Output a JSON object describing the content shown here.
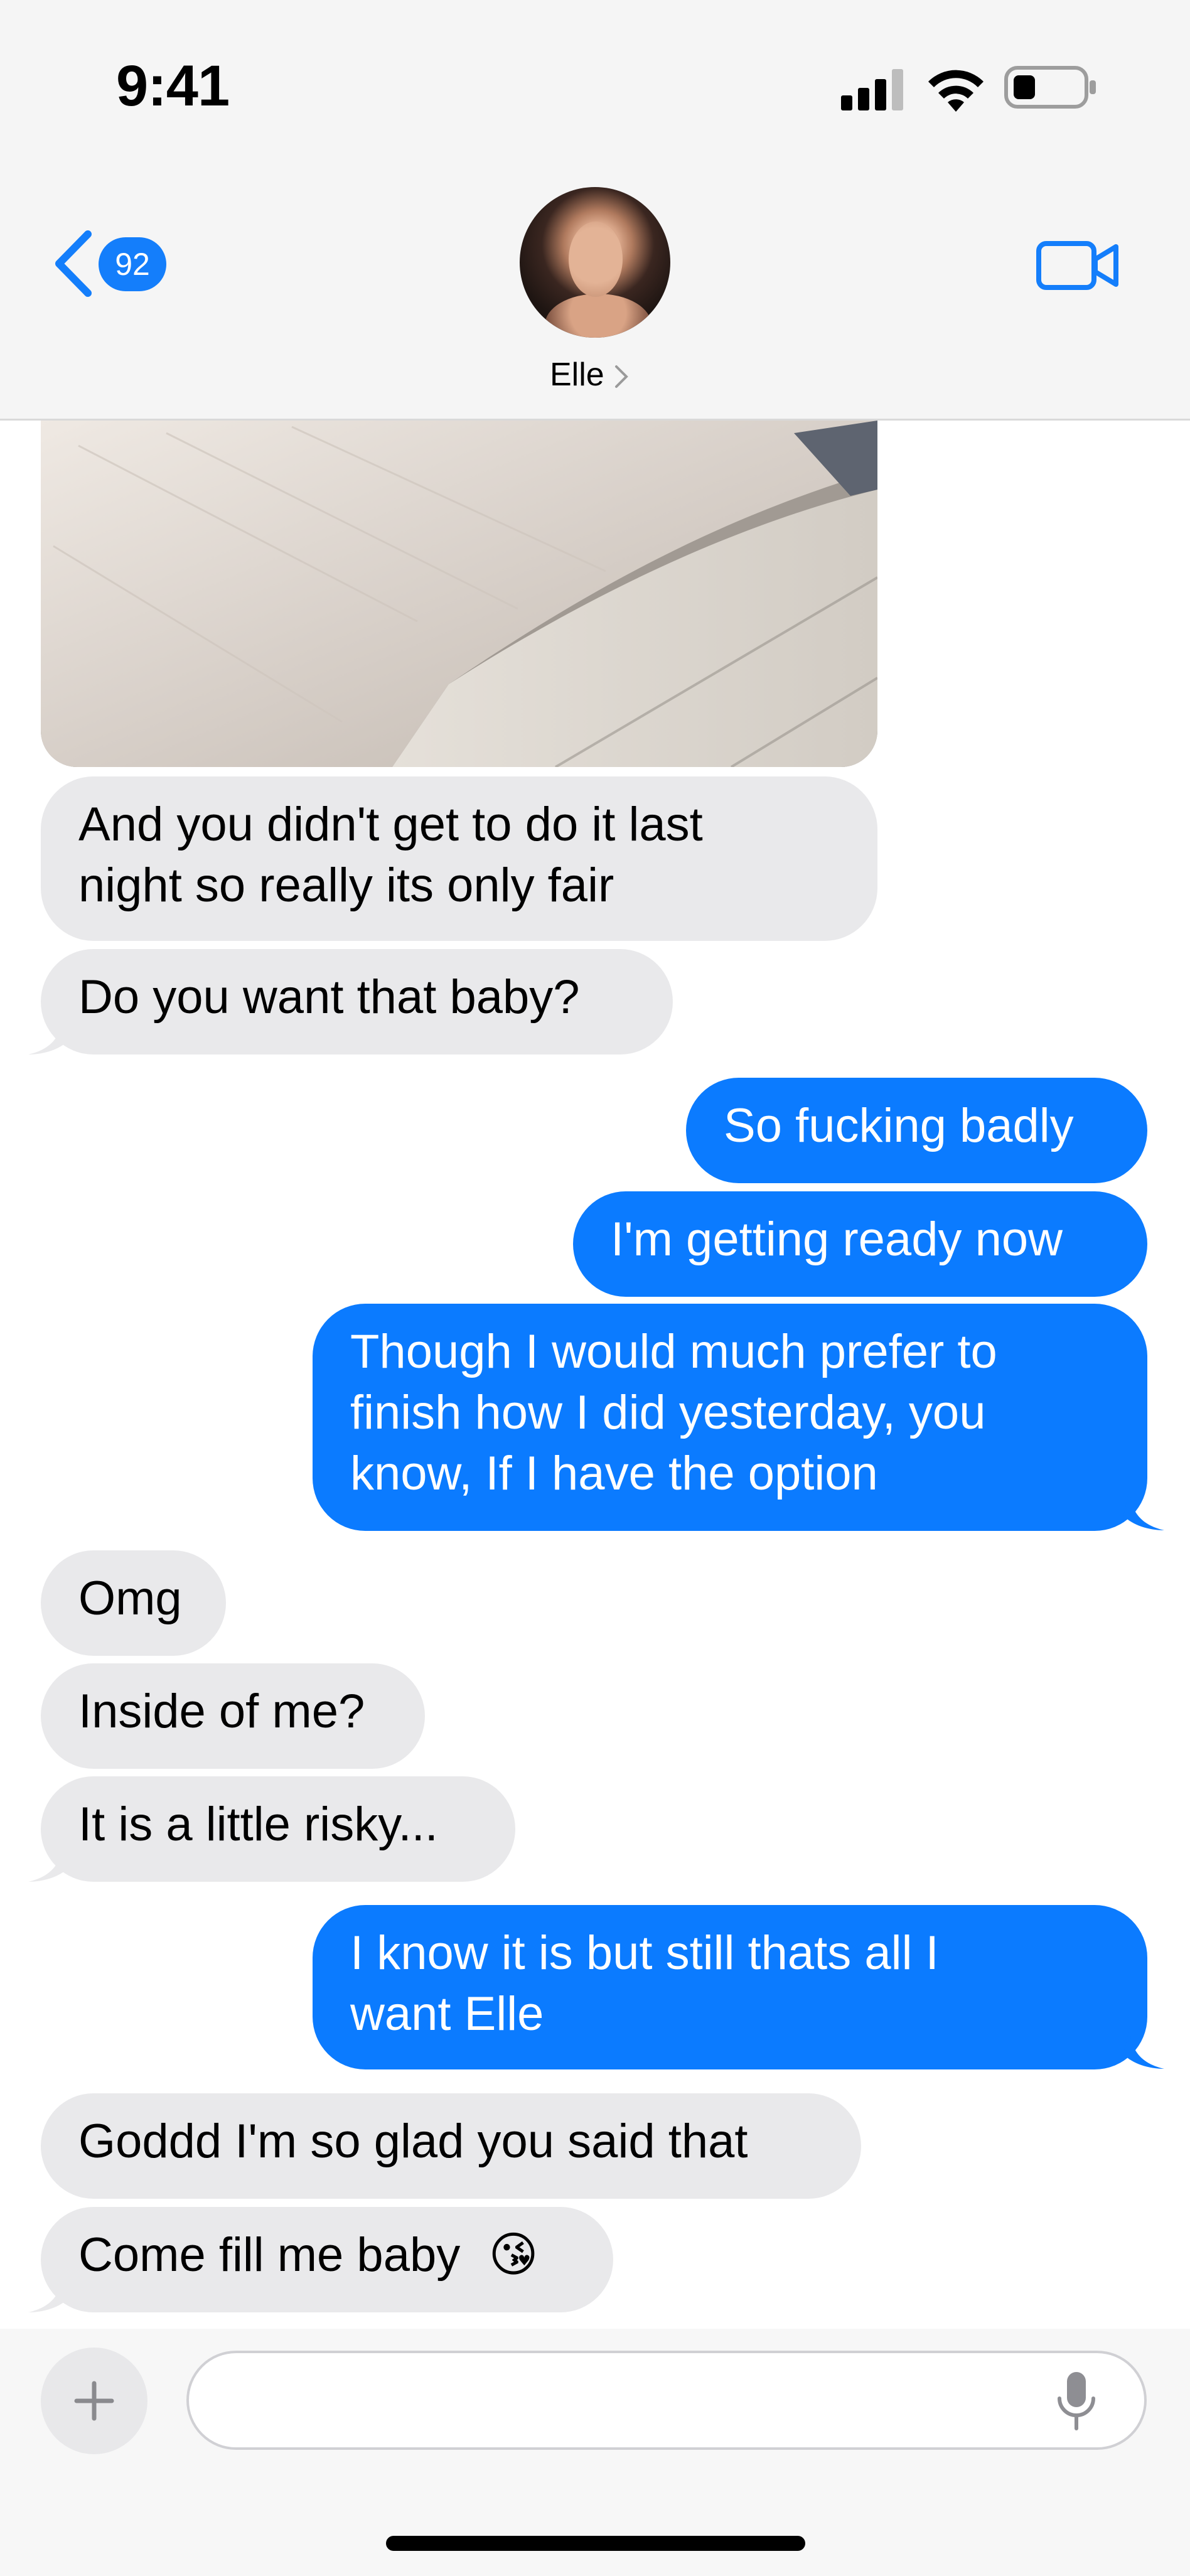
{
  "status_bar": {
    "time": "9:41"
  },
  "header": {
    "back_badge": "92",
    "contact_name": "Elle",
    "icons": [
      "chevron-left-icon",
      "video-camera-icon",
      "signal-icon",
      "wifi-icon",
      "battery-icon"
    ]
  },
  "messages": [
    {
      "from": "them",
      "text_lines": [
        "And you didn't get to do it last",
        "night so really its only fair"
      ]
    },
    {
      "from": "them",
      "text_lines": [
        "Do you want that baby?"
      ]
    },
    {
      "from": "me",
      "text_lines": [
        "So fucking badly"
      ]
    },
    {
      "from": "me",
      "text_lines": [
        "I'm getting ready now"
      ]
    },
    {
      "from": "me",
      "text_lines": [
        "Though I would much prefer to",
        "finish how I did yesterday, you",
        "know, If I have the option"
      ]
    },
    {
      "from": "them",
      "text_lines": [
        "Omg"
      ]
    },
    {
      "from": "them",
      "text_lines": [
        "Inside of me?"
      ]
    },
    {
      "from": "them",
      "text_lines": [
        "It is a little risky..."
      ]
    },
    {
      "from": "me",
      "text_lines": [
        "I know it is but still thats all I",
        "want Elle"
      ]
    },
    {
      "from": "them",
      "text_lines": [
        "Goddd I'm so glad you said that"
      ]
    },
    {
      "from": "them",
      "text_lines": [
        "Come fill me baby",
        "😘"
      ]
    }
  ],
  "input": {
    "placeholder": "",
    "value": ""
  },
  "colors": {
    "outgoing": "#0b7bff",
    "incoming": "#e9e9eb",
    "accent": "#147efb"
  }
}
